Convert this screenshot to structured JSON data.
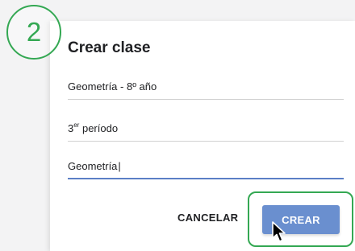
{
  "step_badge": "2",
  "dialog": {
    "title": "Crear clase",
    "fields": {
      "name": "Geometría - 8º año",
      "section_prefix": "3",
      "section_sup": "er",
      "section_suffix": " período",
      "subject": "Geometría",
      "subject_caret": "|"
    },
    "buttons": {
      "cancel": "CANCELAR",
      "create": "CREAR"
    }
  },
  "colors": {
    "accent_green": "#34a853",
    "button_blue": "#6a8fcf",
    "focus_underline": "#5b7fc6"
  },
  "icons": [
    "mouse-pointer-icon"
  ]
}
